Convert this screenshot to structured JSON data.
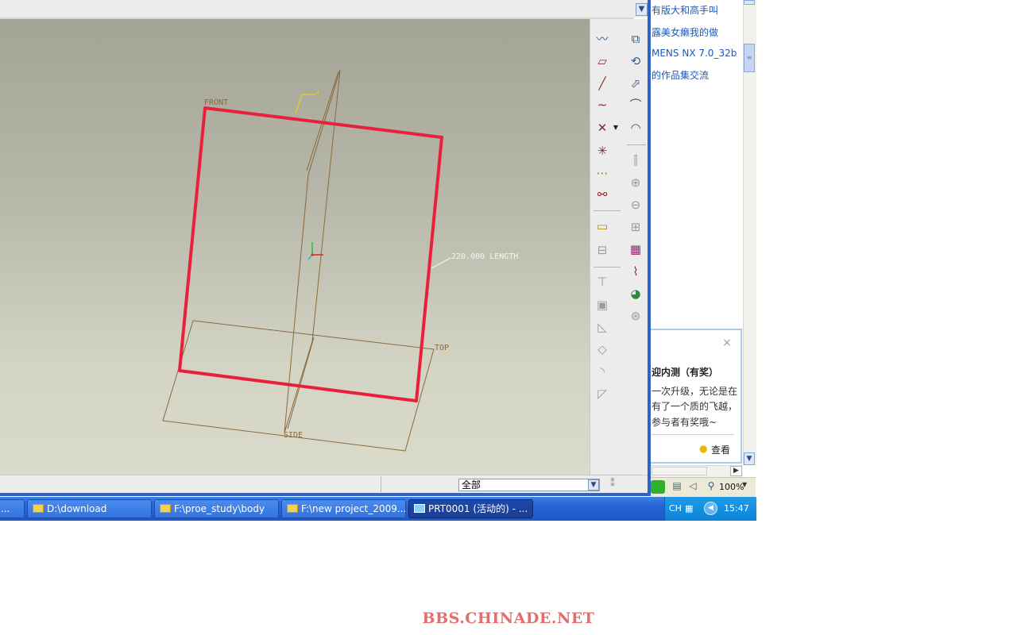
{
  "browser_panel": {
    "links": [
      "有版大和高手叫",
      "露美女癞我的做",
      "MENS NX 7.0_32b",
      "的作品集交流"
    ],
    "popup": {
      "close": "×",
      "title": "迎内测（有奖）",
      "lines": [
        "一次升级，无论是在",
        "有了一个质的飞越，",
        "参与者有奖哦~"
      ],
      "view_label": "查看"
    },
    "zoom": "100%"
  },
  "viewport": {
    "labels": {
      "front": "FRONT",
      "top": "TOP",
      "side": "SIDE",
      "dimension": "220.000 LENGTH"
    }
  },
  "status_bar": {
    "filter_value": "全部"
  },
  "taskbar": {
    "items": [
      {
        "label": "..."
      },
      {
        "label": "D:\\download"
      },
      {
        "label": "F:\\proe_study\\body"
      },
      {
        "label": "F:\\new project_2009..."
      },
      {
        "label": "PRT0001 (活动的) - ..."
      }
    ],
    "tray": {
      "lang": "CH",
      "clock": "15:47"
    }
  },
  "watermark": "BBS.CHINADE.NET",
  "colors": {
    "sketch_line": "#e8203a",
    "datum_plane": "#8a6a3a",
    "taskbar": "#2563d6",
    "link": "#1e58b6"
  },
  "icons": {
    "toolbar": [
      "datum-curve-icon",
      "datum-plane-icon",
      "datum-axis-icon",
      "sketch-curve-icon",
      "datum-point-icon",
      "coordinate-system-icon",
      "offset-point-icon",
      "analysis-icon",
      "annotation-icon",
      "group-icon",
      "extrude-icon",
      "revolve-icon",
      "sweep-icon",
      "blend-icon",
      "hole-icon",
      "shell-icon",
      "rib-icon",
      "draft-icon",
      "round-icon",
      "chamfer-icon",
      "copy-icon",
      "mirror-icon",
      "merge-icon",
      "trim-icon",
      "pattern-icon",
      "style-icon",
      "render-icon",
      "appearance-icon",
      "measure-icon"
    ]
  }
}
